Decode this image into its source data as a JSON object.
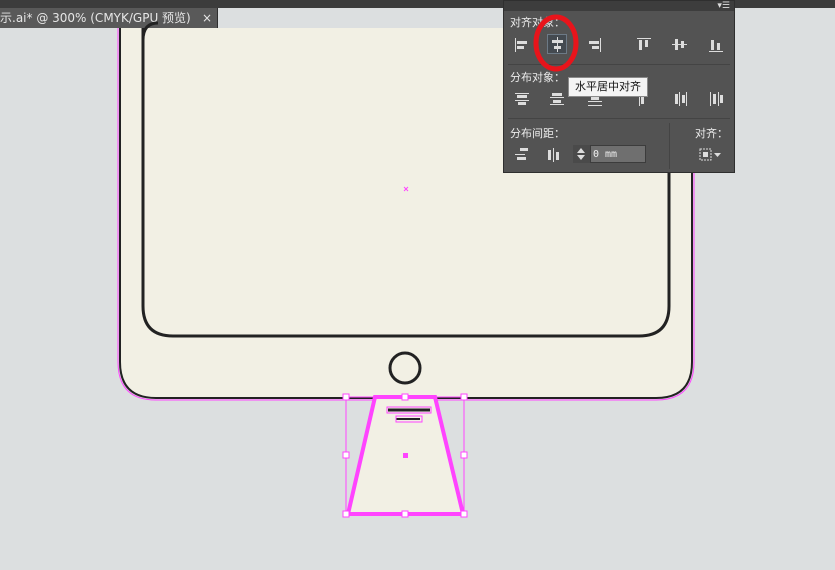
{
  "document_tab": {
    "title": "示.ai* @ 300% (CMYK/GPU 预览)",
    "close_label": "×"
  },
  "align_panel": {
    "align_objects_label": "对齐对象：",
    "distribute_objects_label": "分布对象：",
    "distribute_spacing_label": "分布间距：",
    "align_to_label": "对齐：",
    "spacing_value": "0 mm",
    "tooltip": "水平居中对齐"
  },
  "colors": {
    "canvas": "#dcdfe0",
    "artboard_fill": "#f2f0e4",
    "selection": "#ff44ff",
    "panel_bg": "#535353",
    "highlight_circle": "#e8141b"
  }
}
